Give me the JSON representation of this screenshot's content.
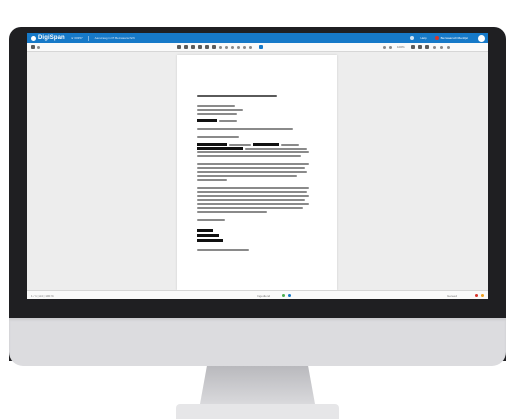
{
  "app": {
    "logo_text": "DigiSpan",
    "tab_left": "nr 00357",
    "breadcrumb": "Aanvraag in PI Bezwaarschrift",
    "help_label": "Help",
    "status_label": "Bezwaarschriftenlijst",
    "status_color": "#d8352a",
    "brand_color": "#1679c8"
  },
  "toolbar": {
    "zoom_label": "100%"
  },
  "statusbar": {
    "left_text": "1 / 1  |  A4  |  100 %",
    "center_text": "Ingediend",
    "right_text": "Gereed"
  },
  "document": {
    "lines": [
      "AANTEKENEN EN PER GEWONE POST",
      "Gemeente Utrecht",
      "Afdeling Juridische zaken",
      "20 juni 2023",
      "Betreft: bezwaarschrift op beslissing van uw college",
      "Geachte heer/mevrouw,",
      "Tegen het besluit van uw gemeente maak ik hierbij bezwaar",
      "Ik verzoek u het besluit te herzien",
      "Hoogachtend,",
      "Bijlage (1): Kopie van het besluit"
    ]
  }
}
